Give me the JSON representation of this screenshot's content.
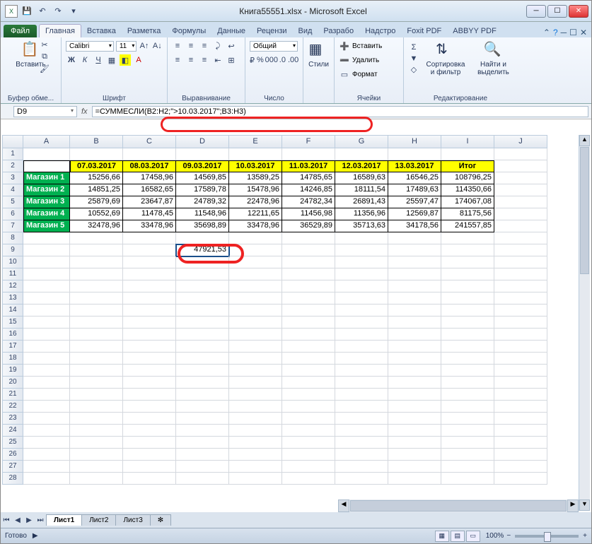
{
  "window": {
    "title": "Книга55551.xlsx - Microsoft Excel"
  },
  "ribbon": {
    "file": "Файл",
    "tabs": [
      "Главная",
      "Вставка",
      "Разметка",
      "Формулы",
      "Данные",
      "Рецензи",
      "Вид",
      "Разрабо",
      "Надстро",
      "Foxit PDF",
      "ABBYY PDF"
    ],
    "active_tab": "Главная",
    "clipboard": {
      "paste": "Вставить",
      "group": "Буфер обме..."
    },
    "font": {
      "name": "Calibri",
      "size": "11",
      "group": "Шрифт"
    },
    "align": {
      "group": "Выравнивание"
    },
    "number": {
      "format": "Общий",
      "group": "Число"
    },
    "styles": {
      "label": "Стили"
    },
    "cells": {
      "insert": "Вставить",
      "delete": "Удалить",
      "format": "Формат",
      "group": "Ячейки"
    },
    "editing": {
      "sort": "Сортировка и фильтр",
      "find": "Найти и выделить",
      "group": "Редактирование"
    }
  },
  "formula_bar": {
    "cell": "D9",
    "fx": "fx",
    "formula": "=СУММЕСЛИ(B2:H2;\">10.03.2017\";B3:H3)"
  },
  "columns": [
    "A",
    "B",
    "C",
    "D",
    "E",
    "F",
    "G",
    "H",
    "I",
    "J"
  ],
  "rows_visible": 28,
  "headers_row": {
    "dates": [
      "07.03.2017",
      "08.03.2017",
      "09.03.2017",
      "10.03.2017",
      "11.03.2017",
      "12.03.2017",
      "13.03.2017"
    ],
    "total": "Итог"
  },
  "data_rows": [
    {
      "shop": "Магазин 1",
      "v": [
        "15256,66",
        "17458,96",
        "14569,85",
        "13589,25",
        "14785,65",
        "16589,63",
        "16546,25"
      ],
      "total": "108796,25"
    },
    {
      "shop": "Магазин 2",
      "v": [
        "14851,25",
        "16582,65",
        "17589,78",
        "15478,96",
        "14246,85",
        "18111,54",
        "17489,63"
      ],
      "total": "114350,66"
    },
    {
      "shop": "Магазин 3",
      "v": [
        "25879,69",
        "23647,87",
        "24789,32",
        "22478,96",
        "24782,34",
        "26891,43",
        "25597,47"
      ],
      "total": "174067,08"
    },
    {
      "shop": "Магазин 4",
      "v": [
        "10552,69",
        "11478,45",
        "11548,96",
        "12211,65",
        "11456,98",
        "11356,96",
        "12569,87"
      ],
      "total": "81175,56"
    },
    {
      "shop": "Магазин 5",
      "v": [
        "32478,96",
        "33478,96",
        "35698,89",
        "33478,96",
        "36529,89",
        "35713,63",
        "34178,56"
      ],
      "total": "241557,85"
    }
  ],
  "result_cell": {
    "row": 9,
    "col": "D",
    "value": "47921,53"
  },
  "sheets": {
    "tabs": [
      "Лист1",
      "Лист2",
      "Лист3"
    ],
    "active": "Лист1"
  },
  "status": {
    "ready": "Готово",
    "zoom": "100%",
    "zoom_out": "−",
    "zoom_in": "+"
  },
  "chart_data": null
}
